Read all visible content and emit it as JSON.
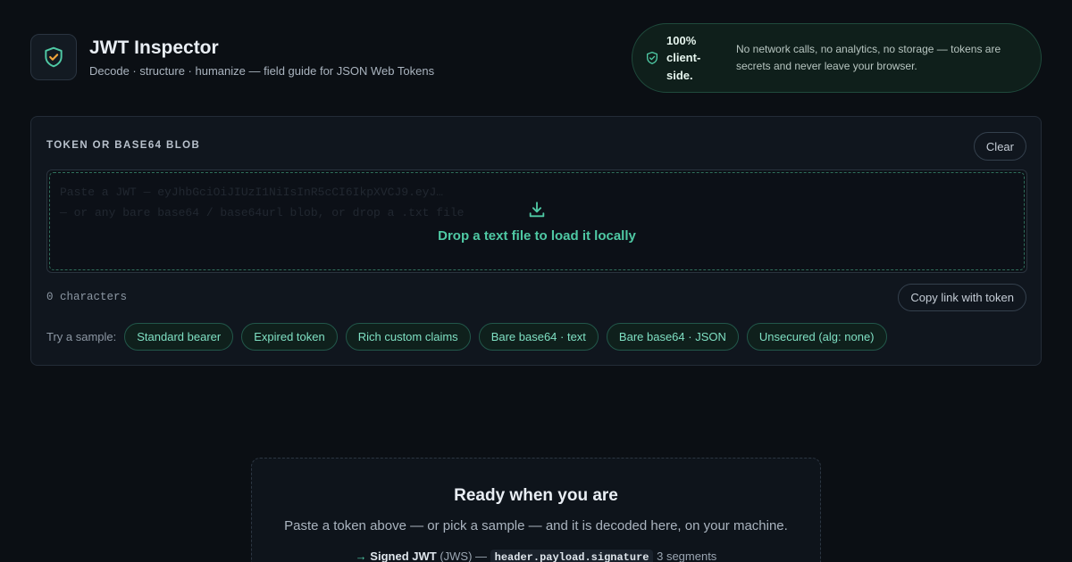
{
  "app": {
    "title": "JWT Inspector",
    "subtitle": "Decode · structure · humanize — field guide for JSON Web Tokens",
    "logo_icon": "shield-check-icon",
    "accent_color": "#4fc9a4"
  },
  "privacy": {
    "icon": "shield-icon",
    "strong": "100% client-side.",
    "text": "No network calls, no analytics, no storage — tokens are secrets and never leave your browser."
  },
  "input_panel": {
    "label": "TOKEN OR BASE64 BLOB",
    "clear_label": "Clear",
    "value": "",
    "placeholder": "Paste a JWT — eyJhbGciOiJIUzI1NiIsInR5cCI6IkpXVCJ9.eyJ…\n— or any bare base64 / base64url blob, or drop a .txt file",
    "drop_icon": "download-icon",
    "drop_text": "Drop a text file to load it locally",
    "char_count": "0 characters",
    "copy_link_label": "Copy link with token",
    "samples_label": "Try a sample:",
    "samples": [
      "Standard bearer",
      "Expired token",
      "Rich custom claims",
      "Bare base64 · text",
      "Bare base64 · JSON",
      "Unsecured (alg: none)"
    ]
  },
  "empty_state": {
    "title": "Ready when you are",
    "text": "Paste a token above — or pick a sample — and it is decoded here, on your machine.",
    "hint_arrow": "→",
    "hint_strong": "Signed JWT",
    "hint_type": "(JWS) —",
    "hint_code": "header.payload.signature",
    "hint_suffix": "3 segments"
  }
}
